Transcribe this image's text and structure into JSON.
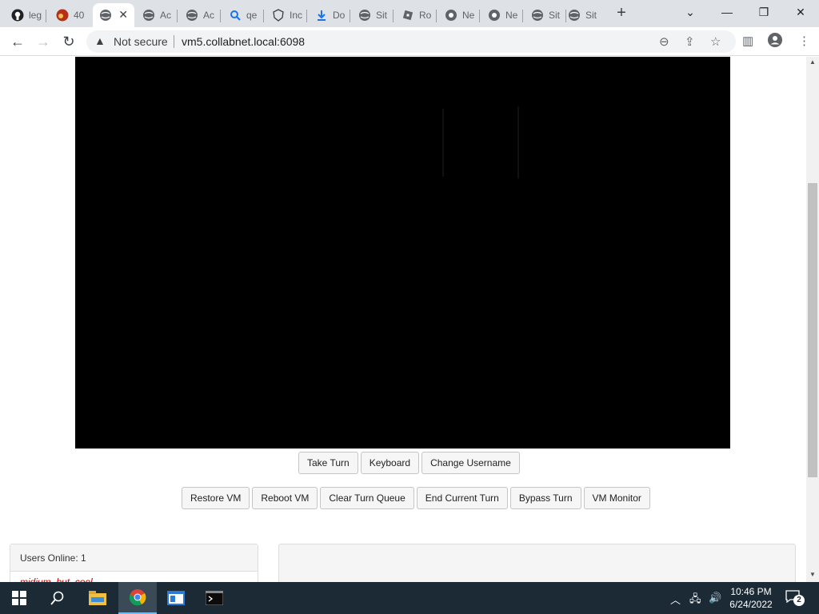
{
  "browser": {
    "tabs": [
      {
        "label": "leg",
        "icon": "github-icon"
      },
      {
        "label": "40",
        "icon": "flame-icon"
      },
      {
        "label": "",
        "icon": "globe-icon",
        "active": true
      },
      {
        "label": "Ac",
        "icon": "globe-icon"
      },
      {
        "label": "Ac",
        "icon": "globe-icon"
      },
      {
        "label": "qe",
        "icon": "search-icon"
      },
      {
        "label": "Inc",
        "icon": "shield-icon"
      },
      {
        "label": "Do",
        "icon": "download-icon"
      },
      {
        "label": "Sit",
        "icon": "globe-icon"
      },
      {
        "label": "Ro",
        "icon": "roblox-icon"
      },
      {
        "label": "Ne",
        "icon": "chrome-icon"
      },
      {
        "label": "Ne",
        "icon": "chrome-icon"
      },
      {
        "label": "Sit",
        "icon": "globe-icon"
      },
      {
        "label": "Sit",
        "icon": "globe-icon"
      }
    ],
    "security_label": "Not secure",
    "url": "vm5.collabnet.local:6098"
  },
  "vm": {
    "row1": [
      "Take Turn",
      "Keyboard",
      "Change Username"
    ],
    "row2": [
      "Restore VM",
      "Reboot VM",
      "Clear Turn Queue",
      "End Current Turn",
      "Bypass Turn",
      "VM Monitor"
    ]
  },
  "users_panel": {
    "header": "Users Online: 1",
    "user": "midium_but_cool"
  },
  "taskbar": {
    "time": "10:46 PM",
    "date": "6/24/2022",
    "notifications": "2"
  },
  "colors": {
    "tabstrip": "#dee1e6",
    "taskbar": "#1c2a35",
    "screen": "#000000"
  }
}
